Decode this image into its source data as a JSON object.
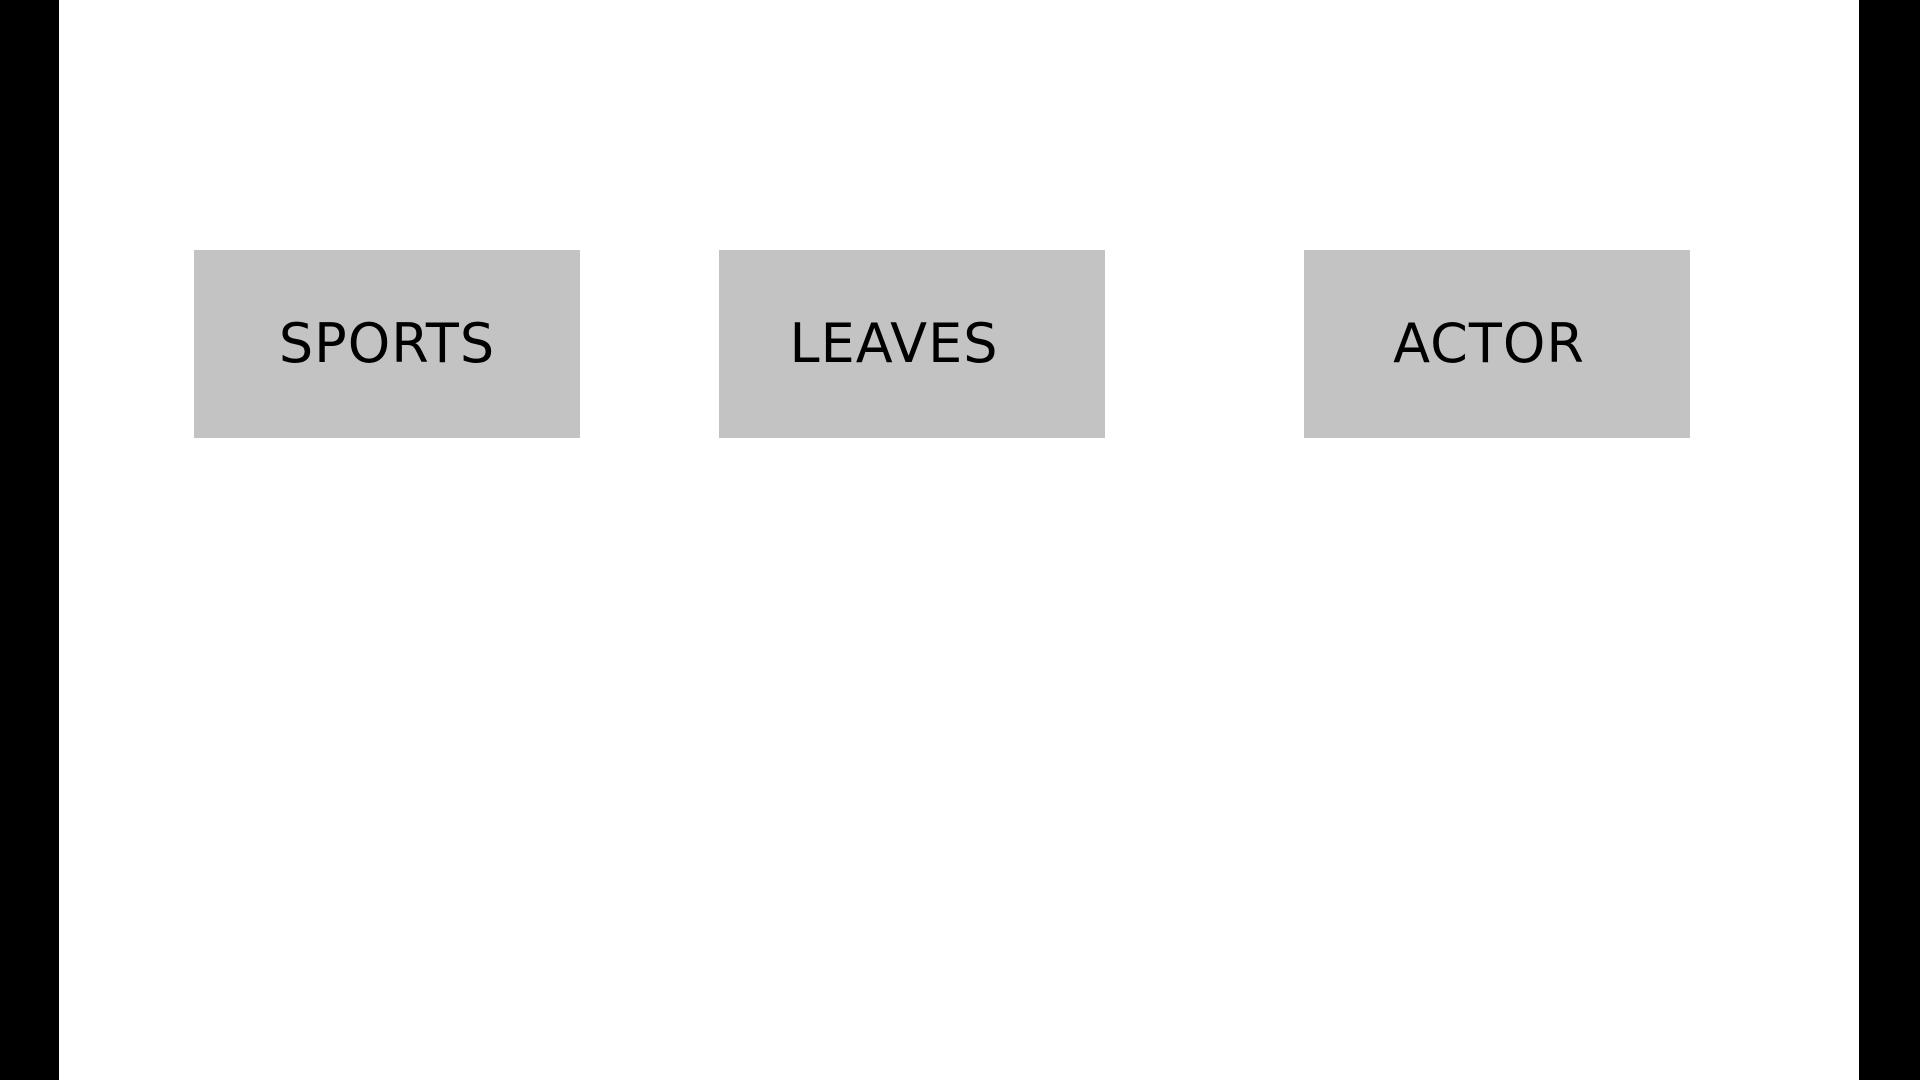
{
  "colors": {
    "page_background": "#000000",
    "canvas_background": "#ffffff",
    "tile_background": "#c3c3c3",
    "tile_text": "#000000"
  },
  "tiles": [
    {
      "label": "SPORTS"
    },
    {
      "label": "LEAVES"
    },
    {
      "label": "ACTOR"
    }
  ]
}
